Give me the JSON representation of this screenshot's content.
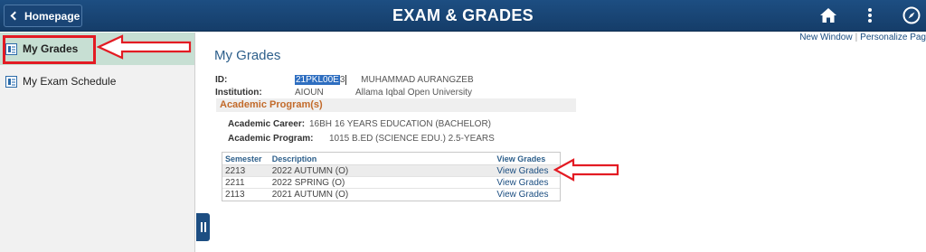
{
  "header": {
    "title": "EXAM & GRADES",
    "home_label": "Homepage"
  },
  "sidebar": {
    "items": [
      {
        "label": "My Grades"
      },
      {
        "label": "My Exam Schedule"
      }
    ]
  },
  "toplinks": {
    "new_window": "New Window",
    "personalize": "Personalize Pag"
  },
  "page": {
    "title": "My Grades",
    "id_label": "ID:",
    "id_selected": "21PKL00E",
    "id_rest": "3",
    "student_name": "MUHAMMAD AURANGZEB",
    "institution_label": "Institution:",
    "institution_code": "AIOUN",
    "institution_name": "Allama Iqbal Open University",
    "section_title": "Academic Program(s)",
    "career_label": "Academic Career:",
    "career_code": "16BH",
    "career_desc": "16 YEARS EDUCATION (BACHELOR)",
    "program_label": "Academic Program:",
    "program_code": "1015",
    "program_desc": "B.ED (SCIENCE EDU.) 2.5-YEARS"
  },
  "grades_table": {
    "headers": [
      "Semester",
      "Description",
      "View Grades"
    ],
    "rows": [
      {
        "semester": "2213",
        "description": "2022 AUTUMN (O)",
        "link": "View Grades"
      },
      {
        "semester": "2211",
        "description": "2022 SPRING (O)",
        "link": "View Grades"
      },
      {
        "semester": "2113",
        "description": "2021 AUTUMN (O)",
        "link": "View Grades"
      }
    ]
  },
  "colors": {
    "header_bg": "#1d4e82",
    "active_bg": "#c7dfd3",
    "annotation": "#e31b23",
    "section_text": "#c26a2a"
  },
  "icons": [
    "chevron-left-icon",
    "home-icon",
    "more-vertical-icon",
    "compass-icon",
    "page-icon",
    "pause-icon",
    "arrow-left-icon"
  ]
}
